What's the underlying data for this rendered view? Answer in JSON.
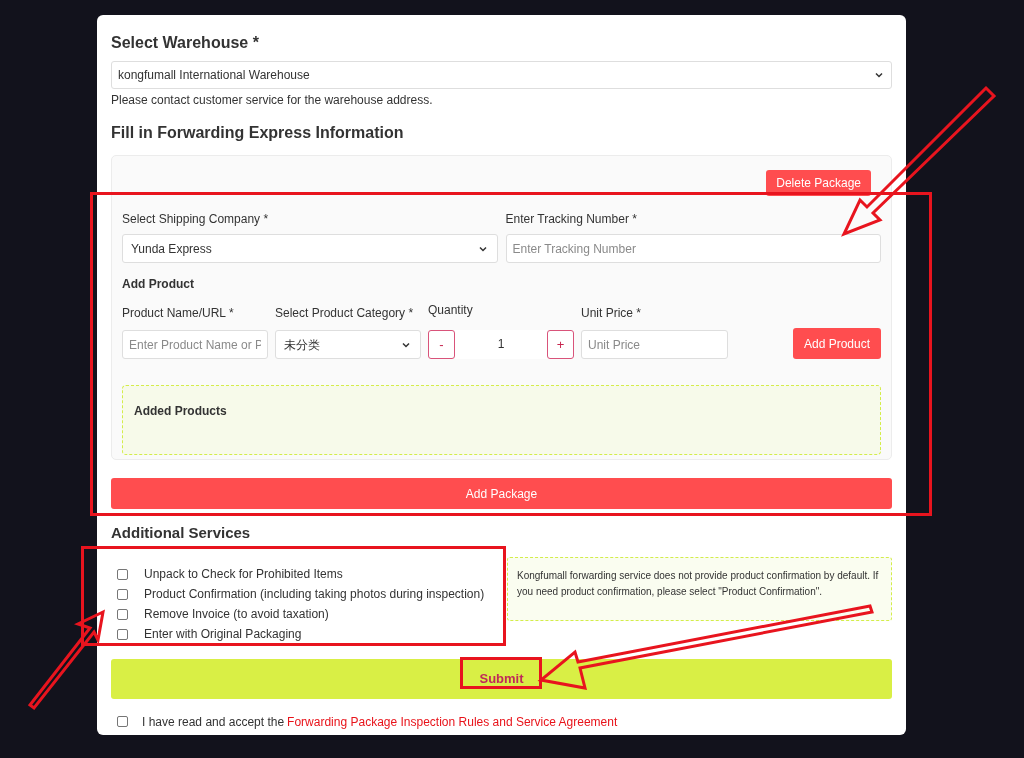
{
  "warehouse": {
    "title": "Select Warehouse *",
    "value": "kongfumall International Warehouse",
    "note": "Please contact customer service for the warehouse address."
  },
  "forwarding": {
    "title": "Fill in Forwarding Express Information",
    "package": {
      "delete_button": "Delete Package",
      "shipping_label": "Select Shipping Company *",
      "shipping_value": "Yunda Express",
      "tracking_label": "Enter Tracking Number *",
      "tracking_placeholder": "Enter Tracking Number",
      "add_product_title": "Add Product",
      "product_name": {
        "label": "Product Name/URL *",
        "placeholder": "Enter Product Name or P"
      },
      "category": {
        "label": "Select Product Category *",
        "value": "未分类"
      },
      "quantity": {
        "label": "Quantity",
        "minus": "-",
        "value": "1",
        "plus": "+"
      },
      "unit_price": {
        "label": "Unit Price *",
        "placeholder": "Unit Price"
      },
      "add_product_button": "Add Product",
      "added_products_title": "Added Products"
    },
    "add_package_button": "Add Package"
  },
  "services": {
    "title": "Additional Services",
    "options": [
      {
        "label": "Unpack to Check for Prohibited Items",
        "checked": false
      },
      {
        "label": "Product Confirmation (including taking photos during inspection)",
        "checked": false
      },
      {
        "label": "Remove Invoice (to avoid taxation)",
        "checked": false
      },
      {
        "label": "Enter with Original Packaging",
        "checked": false
      }
    ],
    "info": "Kongfumall forwarding service does not provide product confirmation by default. If you need product confirmation, please select \"Product Confirmation\"."
  },
  "submit_button": "Submit",
  "agreement": {
    "checked": false,
    "text": "I have read and accept the",
    "link": "Forwarding Package Inspection Rules and Service Agreement"
  }
}
